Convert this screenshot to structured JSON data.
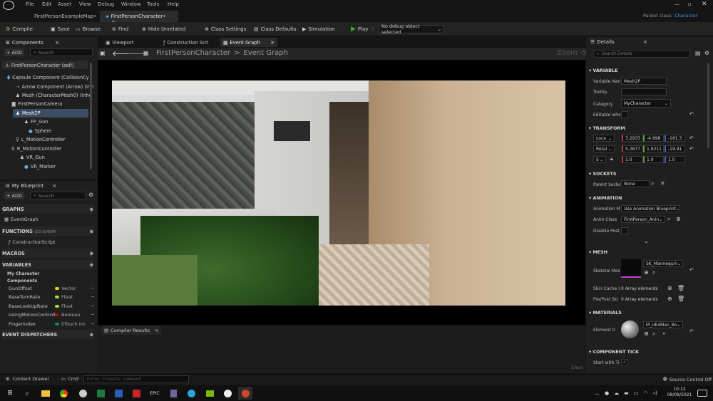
{
  "menu": [
    "File",
    "Edit",
    "Asset",
    "View",
    "Debug",
    "Window",
    "Tools",
    "Help"
  ],
  "doc_tabs": [
    {
      "label": "FirstPersonExampleMap•",
      "close": "×"
    },
    {
      "label": "FirstPersonCharacter•",
      "close": "×"
    }
  ],
  "parent_class": {
    "label": "Parent class:",
    "value": "Character"
  },
  "toolbar": {
    "compile": "Compile",
    "save": "Save",
    "browse": "Browse",
    "find": "Find",
    "hide_unrelated": "Hide Unrelated",
    "class_settings": "Class Settings",
    "class_defaults": "Class Defaults",
    "simulation": "Simulation",
    "play": "Play",
    "debug_object": "No debug object selected"
  },
  "components": {
    "title": "Components",
    "add": "+ ADD",
    "search_placeholder": "Search",
    "items": [
      "FirstPersonCharacter (self)",
      "Capsule Component (CollisionCy",
      "Arrow Component (Arrow) (Inh",
      "Mesh (CharacterMesh0) (Inhe",
      "FirstPersonCamera",
      "Mesh2P",
      "FP_Gun",
      "Sphere",
      "L_MotionController",
      "R_MotionController",
      "VR_Gun",
      "VR_Marker"
    ]
  },
  "my_blueprint": {
    "title": "My Blueprint",
    "add": "+ ADD",
    "search_placeholder": "Search",
    "graphs": "GRAPHS",
    "event_graph": "EventGraph",
    "functions": "FUNCTIONS",
    "functions_override": "(23 OVERR",
    "construction_script": "ConstructionScript",
    "macros": "MACROS",
    "variables": "VARIABLES",
    "my_character": "My Character",
    "components": "Components",
    "vars": [
      {
        "name": "GunOffset",
        "type": "Vector",
        "color": "#f5c800"
      },
      {
        "name": "BaseTurnRate",
        "type": "Float",
        "color": "#9be03a"
      },
      {
        "name": "BaseLookUpRate",
        "type": "Float",
        "color": "#9be03a"
      },
      {
        "name": "UsingMotionControlle",
        "type": "Boolean",
        "color": "#a01010"
      },
      {
        "name": "FingerIndex",
        "type": "ETouch Inc",
        "color": "#0a8a68"
      }
    ],
    "event_dispatchers": "EVENT DISPATCHERS"
  },
  "editor_tabs": [
    {
      "label": "Viewport"
    },
    {
      "label": "Construction Scri"
    },
    {
      "label": "Event Graph",
      "close": "×"
    }
  ],
  "breadcrumb": {
    "root": "FirstPersonCharacter",
    "sep": ">",
    "leaf": "Event Graph",
    "zoom": "Zoom -5"
  },
  "compiler_results": {
    "label": "Compiler Results",
    "close": "×",
    "clear": "Clear"
  },
  "details": {
    "title": "Details",
    "close": "×",
    "search_placeholder": "Search Details",
    "variable": "VARIABLE",
    "variable_name_label": "Variable Nan",
    "variable_name": "Mesh2P",
    "tooltip_label": "Tooltip",
    "category_label": "Category",
    "category": "MyCharacter",
    "editable_label": "Editable whe",
    "transform": "TRANSFORM",
    "loc_label": "Loca",
    "loc": [
      "3.2933",
      "-4.998",
      "-161.3"
    ],
    "rot_label": "Rotal",
    "rot": [
      "5.2877",
      "1.9211",
      "-19.91"
    ],
    "scale_label": "S",
    "scale": [
      "1.0",
      "1.0",
      "1.0"
    ],
    "sockets": "SOCKETS",
    "parent_socket_label": "Parent Socke",
    "parent_socket": "None",
    "animation": "ANIMATION",
    "anim_mode_label": "Animation M",
    "anim_mode": "Use Animation Blueprint",
    "anim_class_label": "Anim Class",
    "anim_class": "FirstPerson_Anin",
    "disable_post_label": "Disable Post",
    "mesh": "MESH",
    "skeletal_label": "Skeletal Mes",
    "skeletal": "SK_Mannequin",
    "skin_cache_label": "Skin Cache U",
    "skin_cache": "0 Array elements",
    "prepost_label": "Pre/Post Ski",
    "prepost": "0 Array elements",
    "materials": "MATERIALS",
    "element0_label": "Element 0",
    "element0": "M_UE4Man_Bo",
    "component_tick": "COMPONENT TICK",
    "start_with_tick": "Start with Ti"
  },
  "bottom": {
    "content_drawer": "Content Drawer",
    "cmd": "Cmd",
    "console_placeholder": "Enter Console Command",
    "source_control": "Source Control Off"
  },
  "clock": {
    "time": "10:12",
    "date": "09/09/2021"
  },
  "colors": {
    "accent": "#0e6fd6",
    "play": "#3fae2a",
    "selection": "#2e4a6a",
    "orange": "#e06a1a"
  }
}
